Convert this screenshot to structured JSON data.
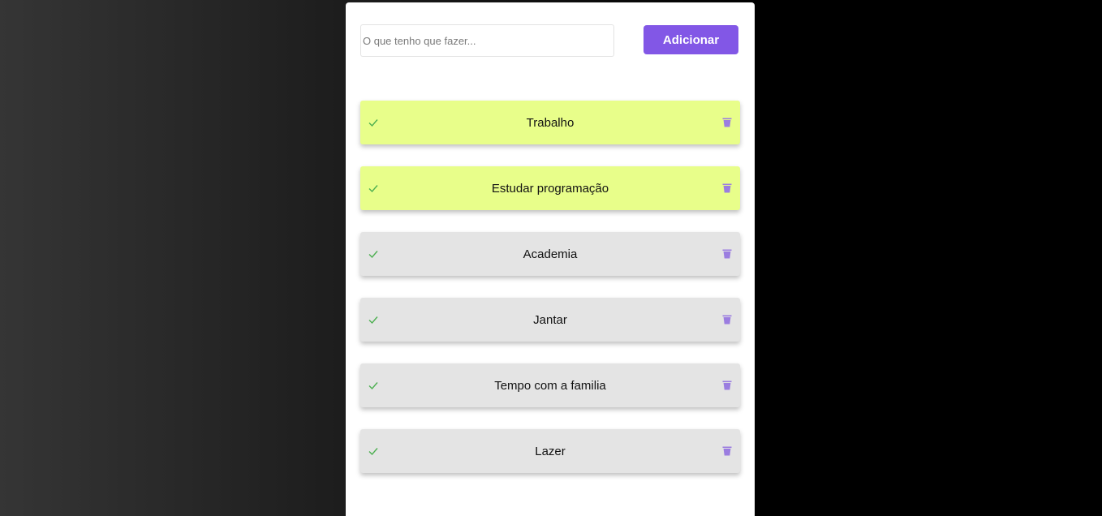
{
  "form": {
    "input_value": "",
    "input_placeholder": "O que tenho que fazer...",
    "add_label": "Adicionar"
  },
  "colors": {
    "accent": "#8257e6",
    "highlight_item": "#e8fe8a",
    "normal_item": "#e4e4e4",
    "check": "#4caf50"
  },
  "icons": {
    "check": "check-icon",
    "delete": "trash-icon"
  },
  "tasks": [
    {
      "label": "Trabalho",
      "highlighted": true
    },
    {
      "label": "Estudar programação",
      "highlighted": true
    },
    {
      "label": "Academia",
      "highlighted": false
    },
    {
      "label": "Jantar",
      "highlighted": false
    },
    {
      "label": "Tempo com a familia",
      "highlighted": false
    },
    {
      "label": "Lazer",
      "highlighted": false
    }
  ]
}
